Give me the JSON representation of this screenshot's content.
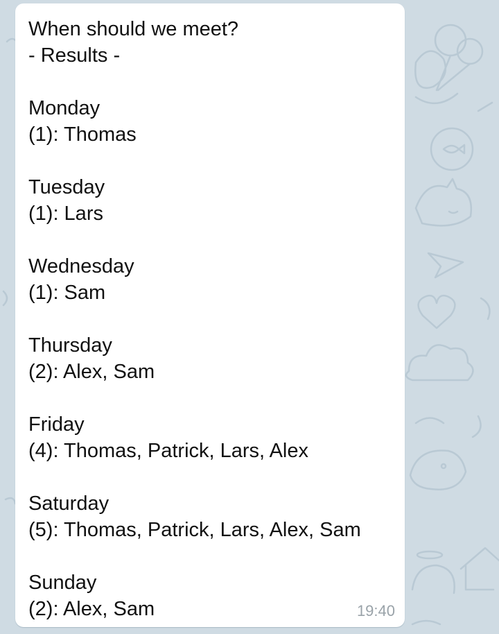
{
  "message": {
    "title": "When should we meet?",
    "subtitle": "- Results -",
    "days": [
      {
        "day": "Monday",
        "result": "(1): Thomas"
      },
      {
        "day": "Tuesday",
        "result": "(1): Lars"
      },
      {
        "day": "Wednesday",
        "result": "(1): Sam"
      },
      {
        "day": "Thursday",
        "result": "(2): Alex, Sam"
      },
      {
        "day": "Friday",
        "result": "(4): Thomas, Patrick, Lars, Alex"
      },
      {
        "day": "Saturday",
        "result": "(5): Thomas, Patrick, Lars, Alex, Sam"
      },
      {
        "day": "Sunday",
        "result": "(2): Alex, Sam"
      }
    ],
    "time": "19:40"
  },
  "colors": {
    "chat_background": "#cfdbe3",
    "bubble": "#ffffff",
    "text": "#111111",
    "timestamp": "#9aa3a9"
  },
  "background_icons": [
    "balloons-icon",
    "cat-icon",
    "fish-icon",
    "paper-plane-icon",
    "cloud-icon",
    "dog-icon",
    "heart-icon",
    "house-icon"
  ]
}
